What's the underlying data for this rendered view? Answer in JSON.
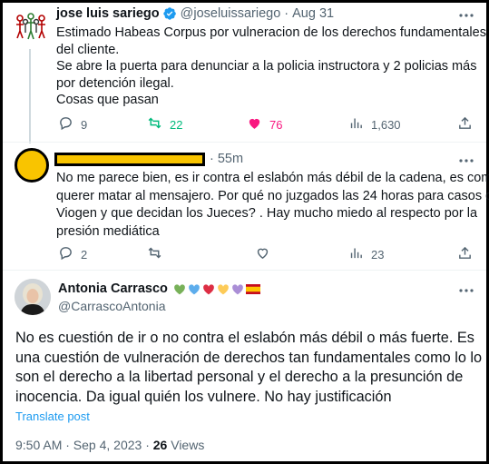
{
  "tweet1": {
    "author_name": "jose luis sariego",
    "handle": "@joseluissariego",
    "separator": "·",
    "date": "Aug 31",
    "lines": [
      "Estimado Habeas Corpus por vulneracion de los derechos fundamentales",
      "del cliente.",
      "Se abre la puerta para denunciar a la policia instructora y 2 policias más",
      "por detención ilegal.",
      "Cosas que pasan"
    ],
    "replies": "9",
    "retweets": "22",
    "likes": "76",
    "views": "1,630",
    "colors": {
      "retweet": "#00ba7c",
      "like": "#f91880",
      "verified": "#1d9bf0"
    }
  },
  "tweet2": {
    "time": "· 55m",
    "lines": [
      "No me parece bien, es ir contra el eslabón más débil de la cadena, es como",
      "querer matar al mensajero. Por qué no juzgados las 24 horas para casos de",
      "Viogen y que decidan los Jueces? . Hay mucho miedo al respecto por la",
      "presión mediática"
    ],
    "replies": "2",
    "views": "23",
    "colors": {
      "redaction": "#f9c400"
    }
  },
  "main_tweet": {
    "author_name": "Antonia Carrasco",
    "handle": "@CarrascoAntonia",
    "lines": [
      "No es cuestión de ir o no contra el eslabón más débil o más fuerte. Es",
      "una cuestión de vulneración de derechos tan fundamentales como lo lo",
      "son el derecho a la libertad personal y el derecho a la presunción de",
      "inocencia. Da igual quién los vulnere. No hay justificación"
    ],
    "translate_label": "Translate post",
    "time": "9:50 AM · Sep 4, 2023 ·",
    "view_count": "26",
    "views_label": "Views",
    "name_emojis": [
      "green-heart",
      "blue-heart",
      "red-heart",
      "yellow-heart",
      "purple-heart",
      "spain-flag"
    ]
  }
}
